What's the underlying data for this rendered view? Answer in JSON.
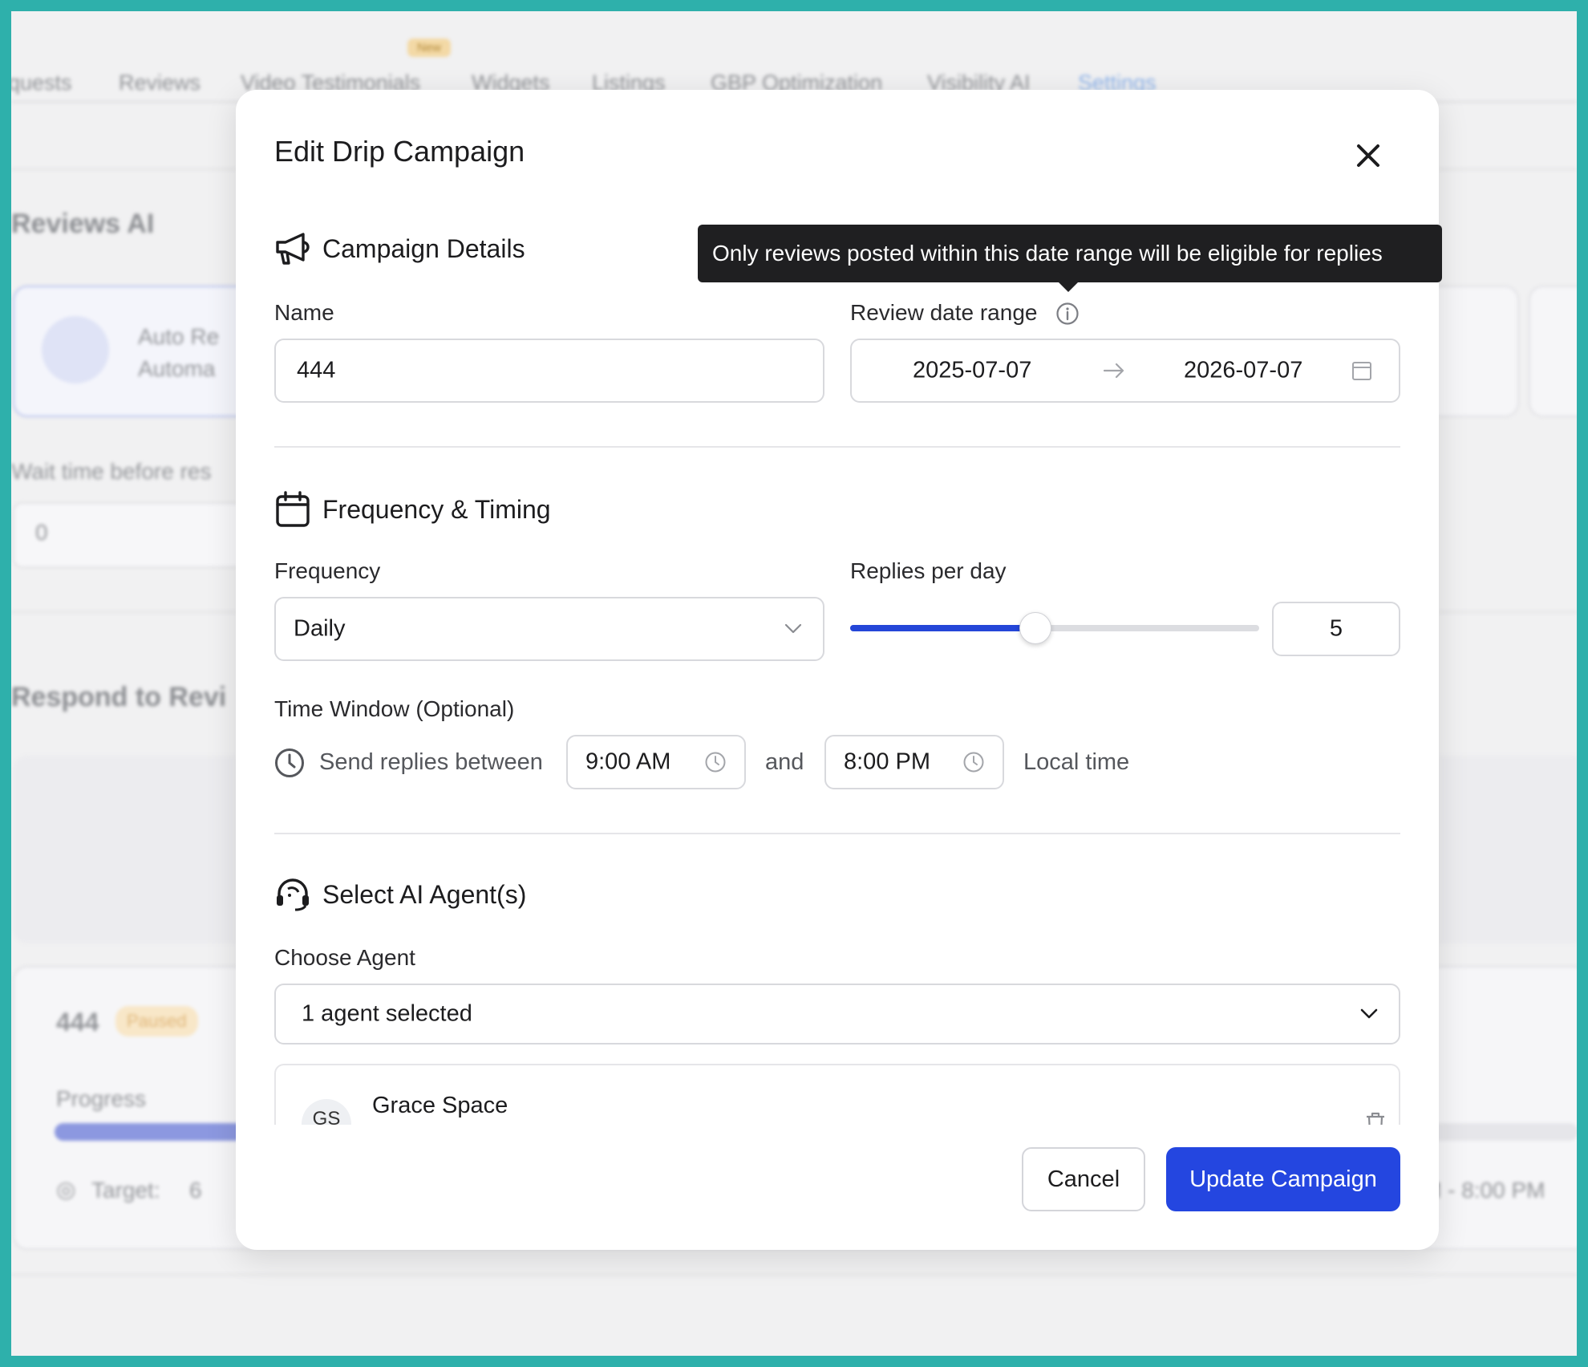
{
  "background": {
    "nav_tabs": [
      "quests",
      "Reviews",
      "Video Testimonials",
      "Widgets",
      "Listings",
      "GBP Optimization",
      "Visibility AI",
      "Settings"
    ],
    "new_badge": "New",
    "section_title": "Reviews AI",
    "card_title": "Auto Re",
    "card_subtitle": "Automa",
    "wait_label": "Wait time before res",
    "wait_value": "0",
    "respond_title": "Respond to Revi",
    "campaign_name": "444",
    "campaign_status": "Paused",
    "progress_label": "Progress",
    "target_label": "Target:",
    "target_value": "6",
    "time_range_fragment": "M - 8:00 PM"
  },
  "modal": {
    "title": "Edit Drip Campaign",
    "campaign_details": {
      "heading": "Campaign Details",
      "name_label": "Name",
      "name_value": "444",
      "date_range_label": "Review date range",
      "start_date": "2025-07-07",
      "end_date": "2026-07-07",
      "tooltip": "Only reviews posted within this date range will be eligible for replies"
    },
    "frequency_timing": {
      "heading": "Frequency & Timing",
      "frequency_label": "Frequency",
      "frequency_value": "Daily",
      "replies_label": "Replies per day",
      "replies_value": "5",
      "slider_fraction": 0.45,
      "time_window_label": "Time Window (Optional)",
      "send_between": "Send replies between",
      "start_time": "9:00 AM",
      "and": "and",
      "end_time": "8:00 PM",
      "local_time": "Local time"
    },
    "agents": {
      "heading": "Select AI Agent(s)",
      "choose_label": "Choose Agent",
      "selected_text": "1 agent selected",
      "agent_name": "Grace Space",
      "agent_initials": "GS"
    },
    "buttons": {
      "cancel": "Cancel",
      "update": "Update Campaign"
    }
  },
  "colors": {
    "primary": "#2446e0",
    "frame": "#2eb0ab",
    "tooltip_bg": "#1f1f21"
  }
}
